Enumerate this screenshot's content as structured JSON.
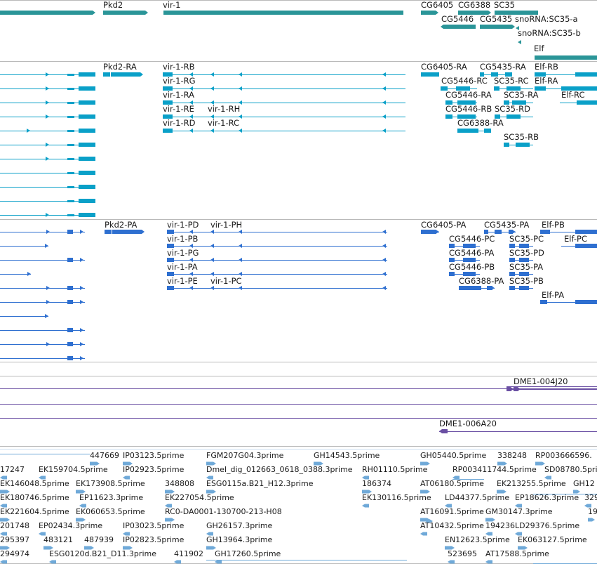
{
  "colors": {
    "gene": "#2a9598",
    "transcript": "#0aa0c8",
    "protein": "#2e6fd0",
    "clone": "#6a4fa3",
    "est": "#6fa9d8",
    "separator": "#b9b9b9"
  },
  "tracks": {
    "genes": [
      {
        "label": "Pkd2",
        "dir": "right"
      },
      {
        "label": "vir-1",
        "dir": "left"
      },
      {
        "label": "CG6405",
        "dir": "right"
      },
      {
        "label": "CG6388",
        "dir": "right"
      },
      {
        "label": "SC35",
        "dir": "left"
      },
      {
        "label": "CG5446",
        "dir": "left"
      },
      {
        "label": "CG5435",
        "dir": "right"
      },
      {
        "label": "snoRNA:SC35-a",
        "dir": "left"
      },
      {
        "label": "snoRNA:SC35-b",
        "dir": "left"
      },
      {
        "label": "Elf",
        "dir": "right"
      }
    ],
    "transcripts": [
      "Pkd2-RA",
      "vir-1-RB",
      "vir-1-RG",
      "vir-1-RA",
      "vir-1-RE",
      "vir-1-RH",
      "vir-1-RD",
      "vir-1-RC",
      "CG6405-RA",
      "CG5435-RA",
      "Elf-RB",
      "CG5446-RC",
      "SC35-RC",
      "Elf-RA",
      "CG5446-RA",
      "SC35-RA",
      "Elf-RC",
      "CG5446-RB",
      "SC35-RD",
      "CG6388-RA",
      "SC35-RB"
    ],
    "proteins": [
      "Pkd2-PA",
      "vir-1-PD",
      "vir-1-PH",
      "vir-1-PB",
      "vir-1-PG",
      "vir-1-PA",
      "vir-1-PE",
      "vir-1-PC",
      "CG6405-PA",
      "CG5435-PA",
      "Elf-PB",
      "CG5446-PC",
      "SC35-PC",
      "Elf-PC",
      "CG5446-PA",
      "SC35-PD",
      "CG5446-PB",
      "SC35-PA",
      "CG6388-PA",
      "SC35-PB",
      "Elf-PA"
    ],
    "clones": [
      "DME1-004J20",
      "DME1-006A20"
    ],
    "ests": [
      "447669",
      "IP03123.5prime",
      "FGM207G04.3prime",
      "GH14543.5prime",
      "GH05440.5prime",
      "338248",
      "RP003666596.",
      "17247",
      "EK159704.5prime",
      "IP02923.5prime",
      "Dmel_dig_012663_0618_0388.3prime",
      "RH01110.5prime",
      "RP003411744.5prime",
      "SD08780.5prime",
      "EK146048.5prime",
      "EK173908.5prime",
      "348808",
      "ESG0115a.B21_H12.3prime",
      "186374",
      "AT06180.5prime",
      "EK213255.5prime",
      "GH12",
      "EK180746.5prime",
      "EP11623.3prime",
      "EK227054.5prime",
      "EK130116.5prime",
      "LD44377.5prime",
      "EP18626.3prime",
      "329",
      "EK221604.5prime",
      "EK060653.5prime",
      "RC0-DA0001-130700-213-H08",
      "AT16091.5prime",
      "GM30147.3prime",
      "190",
      "201748",
      "EP02434.3prime",
      "IP03023.5prime",
      "GH26157.3prime",
      "AT10432.5prime",
      "194236",
      "LD29376.5prime",
      "295397",
      "483121",
      "487939",
      "IP02823.5prime",
      "GH13964.3prime",
      "EN12623.5prime",
      "EK063127.5prime",
      "294974",
      "ESG0120d.B21_D11.3prime",
      "411902",
      "GH17260.5prime",
      "523695",
      "AT17588.5prime"
    ]
  }
}
